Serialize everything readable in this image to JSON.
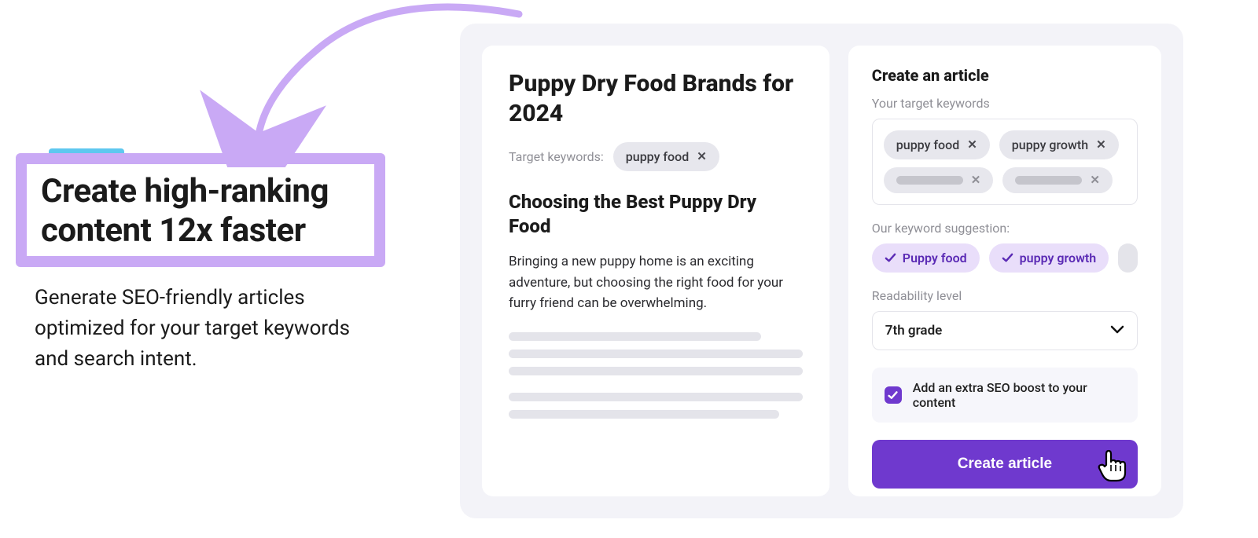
{
  "promo": {
    "headline": "Create high-ranking content 12x faster",
    "sub": "Generate SEO-friendly articles optimized for your target keywords and search intent."
  },
  "article": {
    "title": "Puppy Dry Food Brands for 2024",
    "target_keywords_label": "Target keywords:",
    "target_keywords": [
      "puppy food"
    ],
    "h2": "Choosing the Best Puppy Dry Food",
    "paragraph": "Bringing a new puppy home is an exciting adventure, but choosing the right food for your furry friend can be overwhelming."
  },
  "form": {
    "title": "Create an article",
    "keywords_label": "Your target keywords",
    "keywords": [
      "puppy food",
      "puppy growth"
    ],
    "suggestion_label": "Our keyword suggestion:",
    "suggestions": [
      "Puppy food",
      "puppy growth"
    ],
    "readability_label": "Readability level",
    "readability_value": "7th grade",
    "boost_label": "Add an extra SEO boost to your content",
    "cta_label": "Create article"
  }
}
